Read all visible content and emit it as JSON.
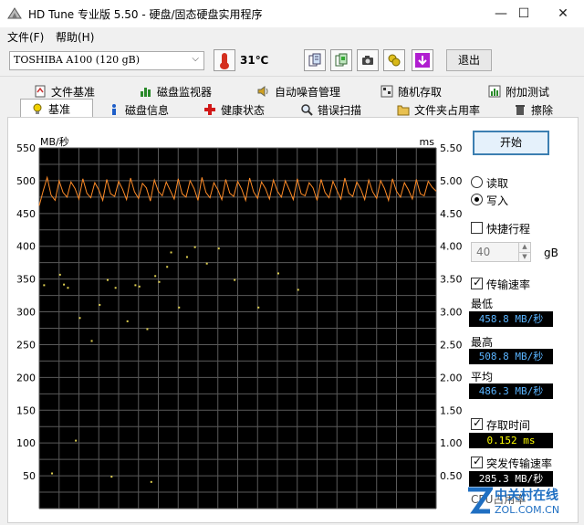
{
  "window": {
    "title": "HD Tune 专业版 5.50 - 硬盘/固态硬盘实用程序",
    "minimize": "—",
    "maximize": "☐",
    "close": "✕"
  },
  "menu": {
    "file": "文件(F)",
    "help": "帮助(H)"
  },
  "toolbar": {
    "drive": "TOSHIBA A100 (120 gB)",
    "temperature": "31℃",
    "exit": "退出",
    "icons": [
      "copy-text-icon",
      "copy-screenshot-icon",
      "camera-icon",
      "options-icon",
      "save-icon"
    ]
  },
  "tabs_top": [
    "文件基准",
    "磁盘监视器",
    "自动噪音管理",
    "随机存取",
    "附加测试"
  ],
  "tabs_bottom": [
    "基准",
    "磁盘信息",
    "健康状态",
    "错误扫描",
    "文件夹占用率",
    "擦除"
  ],
  "controls": {
    "start": "开始",
    "read": "读取",
    "write": "写入",
    "read_selected": false,
    "write_selected": true,
    "short_stroke": "快捷行程",
    "short_stroke_checked": false,
    "short_stroke_value": "40",
    "short_stroke_unit": "gB",
    "transfer_rate": "传输速率",
    "transfer_rate_checked": true,
    "min_label": "最低",
    "min_value": "458.8 MB/秒",
    "max_label": "最高",
    "max_value": "508.8 MB/秒",
    "avg_label": "平均",
    "avg_value": "486.3 MB/秒",
    "access_time": "存取时间",
    "access_time_checked": true,
    "access_value": "0.152 ms",
    "burst_rate": "突发传输速率",
    "burst_rate_checked": true,
    "burst_value": "285.3 MB/秒",
    "cpu_label": "CPU占用率"
  },
  "watermark": {
    "line1": "中关村在线",
    "line2": "ZOL.COM.CN"
  },
  "colors": {
    "transfer_line": "#ff8c28",
    "scatter": "#e0d050",
    "chart_bg": "#000000",
    "grid": "#5a5a5a"
  },
  "chart_data": {
    "type": "line",
    "left_axis_unit": "MB/秒",
    "right_axis_unit": "ms",
    "left_ticks": [
      "550",
      "500",
      "450",
      "400",
      "350",
      "300",
      "250",
      "200",
      "150",
      "100",
      "50"
    ],
    "right_ticks": [
      "5.50",
      "5.00",
      "4.50",
      "4.00",
      "3.50",
      "3.00",
      "2.50",
      "2.00",
      "1.50",
      "1.00",
      "0.50"
    ],
    "ylim_left": [
      0,
      550
    ],
    "ylim_right": [
      0,
      5.5
    ],
    "x_range": [
      0,
      100
    ],
    "grid": true,
    "series": [
      {
        "type": "line",
        "values": [
          462,
          485,
          505,
          478,
          470,
          500,
          482,
          475,
          498,
          488,
          472,
          503,
          481,
          474,
          497,
          486,
          470,
          502,
          480,
          476,
          499,
          487,
          471,
          504,
          483,
          473,
          496,
          489,
          469,
          501,
          484,
          477,
          498,
          485,
          472,
          503,
          480,
          475,
          500,
          488,
          470,
          505,
          482,
          474,
          497,
          486,
          471,
          502,
          481,
          476,
          499,
          487,
          470,
          504,
          483,
          473,
          498,
          488,
          472,
          501,
          484,
          475,
          500,
          486,
          471,
          503,
          480,
          477,
          497,
          489,
          470,
          502,
          482,
          474,
          499,
          485,
          472,
          504,
          481,
          476,
          498,
          487,
          471,
          501,
          483,
          473,
          500,
          488,
          470,
          503,
          484,
          475,
          497,
          486,
          472,
          502,
          480,
          477,
          499,
          490,
          484
        ]
      },
      {
        "type": "scatter",
        "points": [
          {
            "x": 1,
            "y": 3.42
          },
          {
            "x": 5,
            "y": 3.58
          },
          {
            "x": 6,
            "y": 3.43
          },
          {
            "x": 7,
            "y": 3.38
          },
          {
            "x": 10,
            "y": 2.92
          },
          {
            "x": 13,
            "y": 2.57
          },
          {
            "x": 15,
            "y": 3.12
          },
          {
            "x": 17,
            "y": 3.5
          },
          {
            "x": 19,
            "y": 3.38
          },
          {
            "x": 22,
            "y": 2.87
          },
          {
            "x": 24,
            "y": 3.42
          },
          {
            "x": 25,
            "y": 3.4
          },
          {
            "x": 27,
            "y": 2.75
          },
          {
            "x": 29,
            "y": 3.56
          },
          {
            "x": 30,
            "y": 3.47
          },
          {
            "x": 32,
            "y": 3.7
          },
          {
            "x": 33,
            "y": 3.92
          },
          {
            "x": 35,
            "y": 3.08
          },
          {
            "x": 37,
            "y": 3.85
          },
          {
            "x": 39,
            "y": 4.0
          },
          {
            "x": 42,
            "y": 3.75
          },
          {
            "x": 45,
            "y": 3.98
          },
          {
            "x": 49,
            "y": 3.5
          },
          {
            "x": 55,
            "y": 3.08
          },
          {
            "x": 60,
            "y": 3.6
          },
          {
            "x": 65,
            "y": 3.35
          },
          {
            "x": 3,
            "y": 0.55
          },
          {
            "x": 9,
            "y": 1.05
          },
          {
            "x": 18,
            "y": 0.5
          },
          {
            "x": 28,
            "y": 0.42
          }
        ]
      }
    ]
  }
}
